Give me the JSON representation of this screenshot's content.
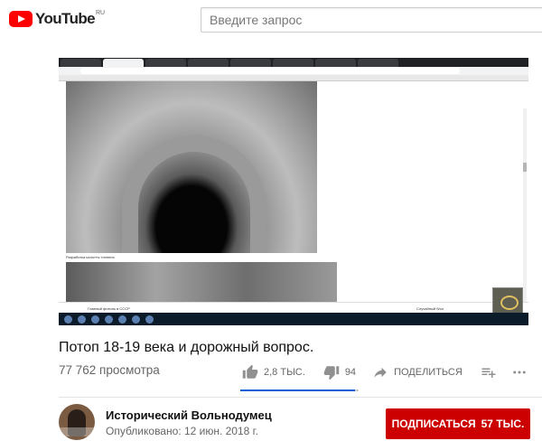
{
  "masthead": {
    "logo_text": "YouTube",
    "region": "RU",
    "search_placeholder": "Введите запрос"
  },
  "player": {
    "caption": "Разработка калотты тоннеля",
    "blog_left": "Главный фитиль в СССР",
    "blog_right": "Случайный блог"
  },
  "video": {
    "title": "Потоп 18-19 века и дорожный вопрос.",
    "views": "77 762 просмотра",
    "likes": "2,8 ТЫС.",
    "dislikes": "94",
    "share_label": "ПОДЕЛИТЬСЯ",
    "like_ratio": 0.97
  },
  "channel": {
    "name": "Исторический Вольнодумец",
    "published": "Опубликовано: 12 июн. 2018 г.",
    "subscribe_label": "ПОДПИСАТЬСЯ",
    "subscriber_count": "57 ТЫС."
  },
  "colors": {
    "brand": "#ff0000",
    "subscribe": "#cc0000",
    "sentiment": "#065fd4"
  }
}
